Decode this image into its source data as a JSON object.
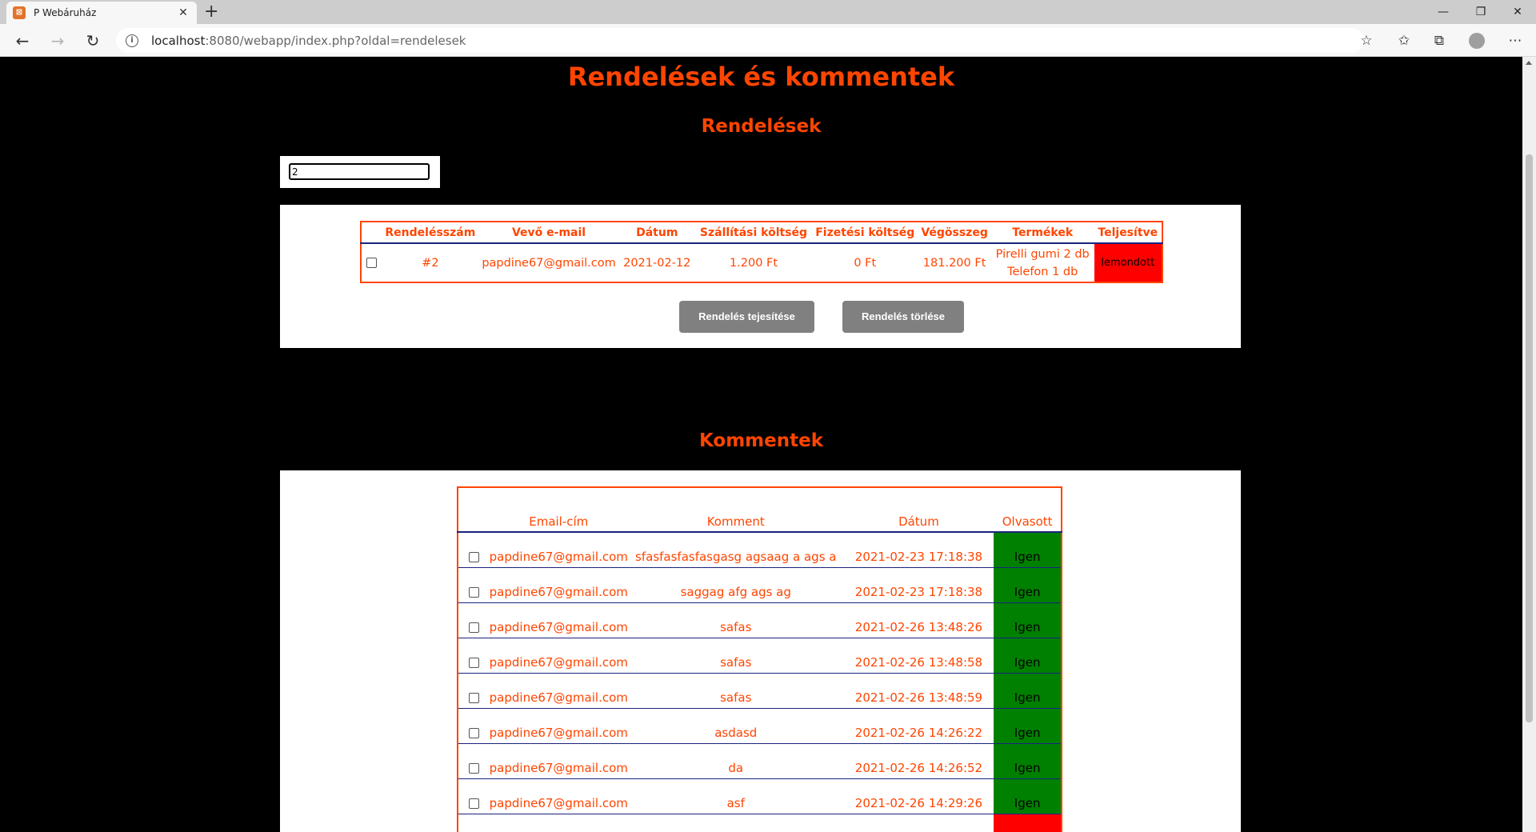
{
  "browser": {
    "tab_title": "P Webáruház",
    "url_host": "localhost",
    "url_rest": ":8080/webapp/index.php?oldal=rendelesek"
  },
  "page": {
    "title": "Rendelések és kommentek",
    "orders_heading": "Rendelések",
    "comments_heading": "Kommentek",
    "filter_value": "2"
  },
  "orders": {
    "headers": [
      "Rendelésszám",
      "Vevő e-mail",
      "Dátum",
      "Szállítási költség",
      "Fizetési költség",
      "Végösszeg",
      "Termékek",
      "Teljesítve"
    ],
    "rows": [
      {
        "number": "#2",
        "email": "papdine67@gmail.com",
        "date": "2021-02-12",
        "shipping": "1.200 Ft",
        "payment": "0 Ft",
        "total": "181.200 Ft",
        "product1": "Pirelli gumi 2 db",
        "product2": "Telefon 1 db",
        "status": "lemondott"
      }
    ],
    "complete_button": "Rendelés tejesítése",
    "delete_button": "Rendelés törlése"
  },
  "comments": {
    "headers": [
      "Email-cím",
      "Komment",
      "Dátum",
      "Olvasott"
    ],
    "rows": [
      {
        "email": "papdine67@gmail.com",
        "comment": "sfasfasfasfasgasg agsaag a ags a",
        "date": "2021-02-23 17:18:38",
        "read": "Igen"
      },
      {
        "email": "papdine67@gmail.com",
        "comment": "saggag afg ags ag",
        "date": "2021-02-23 17:18:38",
        "read": "Igen"
      },
      {
        "email": "papdine67@gmail.com",
        "comment": "safas",
        "date": "2021-02-26 13:48:26",
        "read": "Igen"
      },
      {
        "email": "papdine67@gmail.com",
        "comment": "safas",
        "date": "2021-02-26 13:48:58",
        "read": "Igen"
      },
      {
        "email": "papdine67@gmail.com",
        "comment": "safas",
        "date": "2021-02-26 13:48:59",
        "read": "Igen"
      },
      {
        "email": "papdine67@gmail.com",
        "comment": "asdasd",
        "date": "2021-02-26 14:26:22",
        "read": "Igen"
      },
      {
        "email": "papdine67@gmail.com",
        "comment": "da",
        "date": "2021-02-26 14:26:52",
        "read": "Igen"
      },
      {
        "email": "papdine67@gmail.com",
        "comment": "asf",
        "date": "2021-02-26 14:29:26",
        "read": "Igen"
      }
    ]
  },
  "colors": {
    "accent": "#ff4500",
    "read_yes": "#008000",
    "status_cancelled": "#ff0000"
  }
}
